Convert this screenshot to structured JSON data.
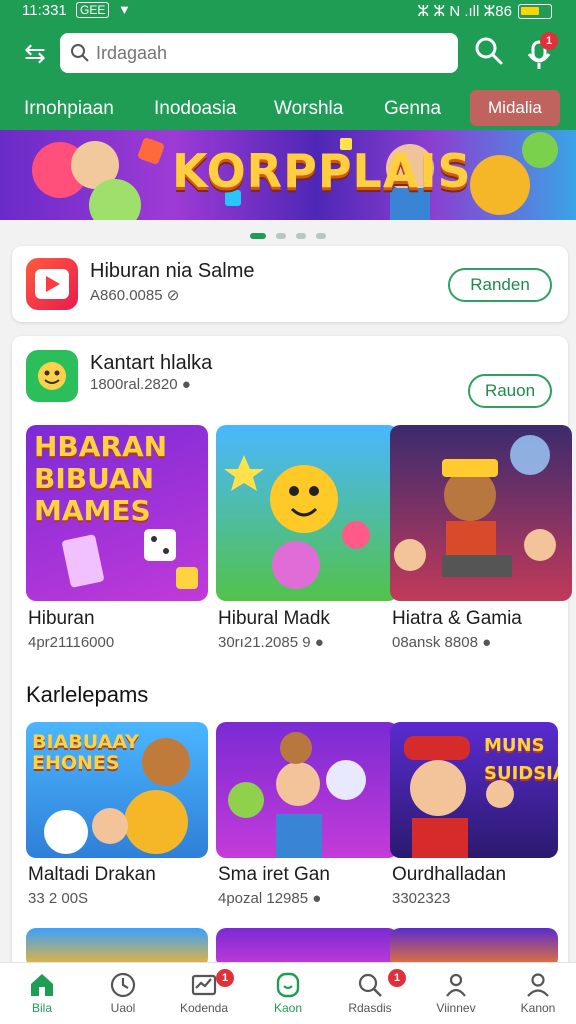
{
  "status": {
    "time": "11:331",
    "carrier": "GEE",
    "right_text": "ⵣ  ⵣ N .ıll  ⵣ86"
  },
  "header": {
    "search_placeholder": "Irdagaah"
  },
  "tabs": [
    {
      "label": "Irnohpiaan"
    },
    {
      "label": "Inodoasia"
    },
    {
      "label": "Worshla"
    },
    {
      "label": "Genna"
    },
    {
      "label": "Midalia",
      "active": true
    }
  ],
  "banner": {
    "title": "KORPPLAIS",
    "slides": 4,
    "active_slide": 1
  },
  "featured": {
    "name": "Hiburan nia Salme",
    "meta": "A860.0085 ⊘",
    "button": "Randen"
  },
  "section1": {
    "name": "Kantart hlalka",
    "meta": "1800ral.2820 ●",
    "button": "Rauon",
    "items": [
      {
        "art": "HBARAN BIBUAN MAMES",
        "label": "Hiburan",
        "meta": "4pr21116000"
      },
      {
        "art": "",
        "label": "Hibural Madk",
        "meta": "30rı21.2085 9 ●"
      },
      {
        "art": "",
        "label": "Hiatra & Gamia",
        "meta": "08ansk 8808 ●"
      }
    ]
  },
  "section2": {
    "title": "Karlelepams",
    "items": [
      {
        "art": "BIABUAAY EHONES",
        "label": "Maltadi Drakan",
        "meta": "33 2 00S"
      },
      {
        "art": "",
        "label": "Sma iret Gan",
        "meta": "4pozal 12985 ●"
      },
      {
        "art": "MUNS SUIDSIAS",
        "label": "Ourdhalladan",
        "meta": "3302323"
      }
    ]
  },
  "bottom_nav": [
    {
      "label": "Bila",
      "icon": "home-icon",
      "active": true
    },
    {
      "label": "Uaol",
      "icon": "clock-icon"
    },
    {
      "label": "Kodenda",
      "icon": "inbox-icon",
      "badge": "1"
    },
    {
      "label": "Kaon",
      "icon": "chat-icon"
    },
    {
      "label": "Rdasdis",
      "icon": "search-icon",
      "badge": "1"
    },
    {
      "label": "Viinnev",
      "icon": "people-icon"
    },
    {
      "label": "Kanon",
      "icon": "person-icon"
    }
  ],
  "colors": {
    "brand": "#1f9d55",
    "tab_active": "#c0635e",
    "badge": "#e0303a"
  }
}
